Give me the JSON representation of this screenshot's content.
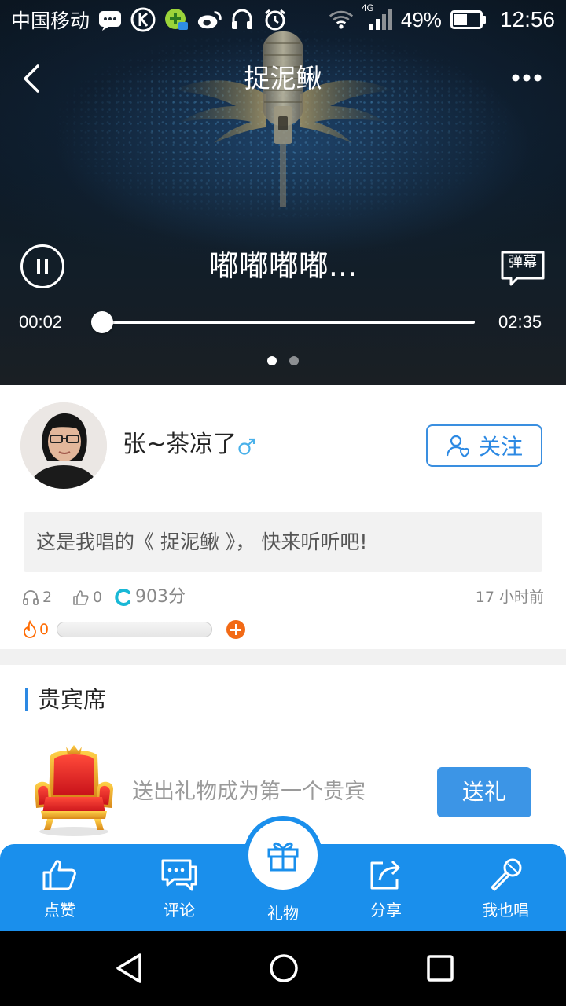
{
  "status_bar": {
    "carrier": "中国移动",
    "network": "4G",
    "battery": "49%",
    "time": "12:56"
  },
  "header": {
    "title": "捉泥鳅"
  },
  "player": {
    "lyric": "嘟嘟嘟嘟...",
    "danmu_label": "弹幕",
    "current_time": "00:02",
    "total_time": "02:35",
    "progress": 0.013,
    "page_count": 2,
    "active_page": 0
  },
  "singer": {
    "name": "张~茶凉了",
    "gender": "male",
    "follow_label": "关注"
  },
  "intro": {
    "text": "这是我唱的《 捉泥鳅 》，  快来听听吧!"
  },
  "stats": {
    "listens": "2",
    "likes": "0",
    "score": "903分",
    "posted": "17 小时前",
    "heat": "0",
    "heat_level": 0
  },
  "vip": {
    "title": "贵宾席",
    "hint": "送出礼物成为第一个贵宾",
    "send_label": "送礼"
  },
  "toolbar": {
    "like_label": "点赞",
    "comment_label": "评论",
    "gift_label": "礼物",
    "share_label": "分享",
    "sing_label": "我也唱"
  },
  "colors": {
    "accent": "#1a8fec",
    "follow": "#2c89e3",
    "heat": "#f26a16",
    "score_c": "#19b8d6"
  },
  "icons": {
    "back": "chevron-left-icon",
    "more": "more-dots-icon",
    "pause": "pause-icon",
    "danmu": "danmu-icon",
    "headphones": "headphones-icon",
    "like": "thumbs-up-icon",
    "score": "score-c-icon",
    "fire": "fire-icon",
    "gift": "gift-icon",
    "comment": "chat-bubble-icon",
    "share": "share-icon",
    "mic": "microphone-icon"
  }
}
